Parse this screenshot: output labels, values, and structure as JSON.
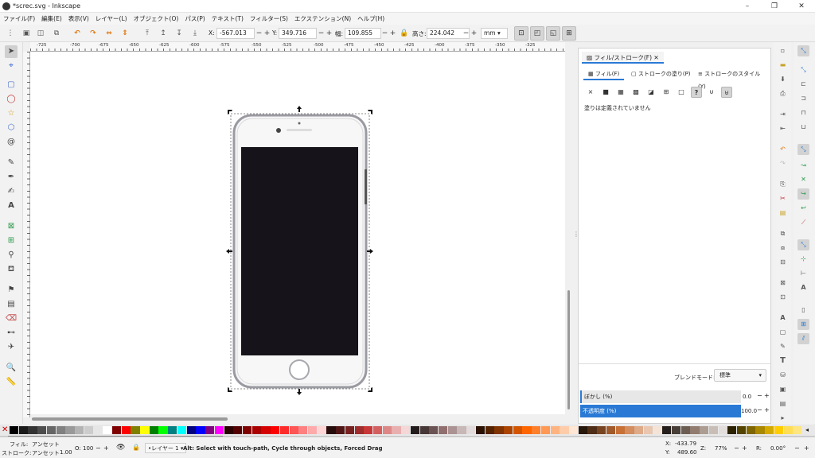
{
  "window": {
    "title": "*screc.svg - Inkscape",
    "minimize": "–",
    "maximize": "❐",
    "close": "✕"
  },
  "menu": [
    "ファイル(F)",
    "編集(E)",
    "表示(V)",
    "レイヤー(L)",
    "オブジェクト(O)",
    "パス(P)",
    "テキスト(T)",
    "フィルター(S)",
    "エクステンション(N)",
    "ヘルプ(H)"
  ],
  "controls": {
    "x_label": "X:",
    "x_value": "-567.013",
    "y_label": "Y:",
    "y_value": "349.716",
    "w_label": "幅:",
    "w_value": "109.855",
    "h_label": "高さ:",
    "h_value": "224.042",
    "unit": "mm"
  },
  "ruler_labels": [
    "-725",
    "-700",
    "-675",
    "-650",
    "-625",
    "-600",
    "-575",
    "-550",
    "-525",
    "-500",
    "-475",
    "-450",
    "-425",
    "-400",
    "-375",
    "-350",
    "-325"
  ],
  "dialog": {
    "tab_title": "フィル/ストローク(F)",
    "subtabs": [
      "フィル(F)",
      "ストロークの塗り(P)",
      "ストロークのスタイル(Y)"
    ],
    "paint_buttons": [
      "×",
      "■",
      "▦",
      "▩",
      "◪",
      "⊞",
      "□",
      "?",
      "⊍",
      "⊎"
    ],
    "fill_status": "塗りは定義されていません",
    "blend_label": "ブレンドモード:",
    "blend_value": "標準",
    "blur_label": "ぼかし (%)",
    "blur_value": "0.0",
    "opacity_label": "不透明度 (%)",
    "opacity_value": "100.0"
  },
  "status": {
    "fill_label": "フィル:",
    "fill_value": "アンセット",
    "stroke_label": "ストローク:",
    "stroke_value": "アンセット",
    "stroke_width": "1.00",
    "opacity_label": "O:",
    "opacity_value": "100",
    "layer": "•レイヤー 1",
    "message": "Alt: Select with touch-path, Cycle through objects, Forced Drag",
    "cx_label": "X:",
    "cx": "-433.79",
    "cy_label": "Y:",
    "cy": "489.60",
    "zoom_label": "Z:",
    "zoom": "77%",
    "rotate_label": "R:",
    "rotate": "0.00°"
  },
  "palette_colors": [
    "#000000",
    "#1a1a1a",
    "#333333",
    "#4d4d4d",
    "#666666",
    "#808080",
    "#999999",
    "#b3b3b3",
    "#cccccc",
    "#e6e6e6",
    "#ffffff",
    "#800000",
    "#ff0000",
    "#808000",
    "#ffff00",
    "#008000",
    "#00ff00",
    "#008080",
    "#00ffff",
    "#000080",
    "#0000ff",
    "#800080",
    "#ff00ff",
    "#2b0000",
    "#550000",
    "#800000",
    "#aa0000",
    "#d40000",
    "#ff0000",
    "#ff2a2a",
    "#ff5555",
    "#ff8080",
    "#ffaaaa",
    "#ffd5d5",
    "#280b0b",
    "#501616",
    "#782121",
    "#a02c2c",
    "#c83737",
    "#d35f5f",
    "#de8787",
    "#e9afaf",
    "#f4d7d7",
    "#241c1c",
    "#483737",
    "#6c5353",
    "#916f6f",
    "#ac9393",
    "#c8b7b7",
    "#e3dbdb",
    "#2b1100",
    "#552200",
    "#803300",
    "#aa4400",
    "#d45500",
    "#ff6600",
    "#ff7f2a",
    "#ff9955",
    "#ffb380",
    "#ffccaa",
    "#ffe6d5",
    "#28170b",
    "#502d16",
    "#784421",
    "#a05a2c",
    "#c87137",
    "#d38d5f",
    "#deaa87",
    "#e9c6af",
    "#f4e3d7",
    "#241f1c",
    "#483e37",
    "#6c5d53",
    "#917c6f",
    "#ac9d93",
    "#c8beb7",
    "#e3dedb",
    "#2b2200",
    "#554400",
    "#806600",
    "#aa8800",
    "#d4aa00",
    "#ffcc00",
    "#ffdd55",
    "#ffe680"
  ]
}
